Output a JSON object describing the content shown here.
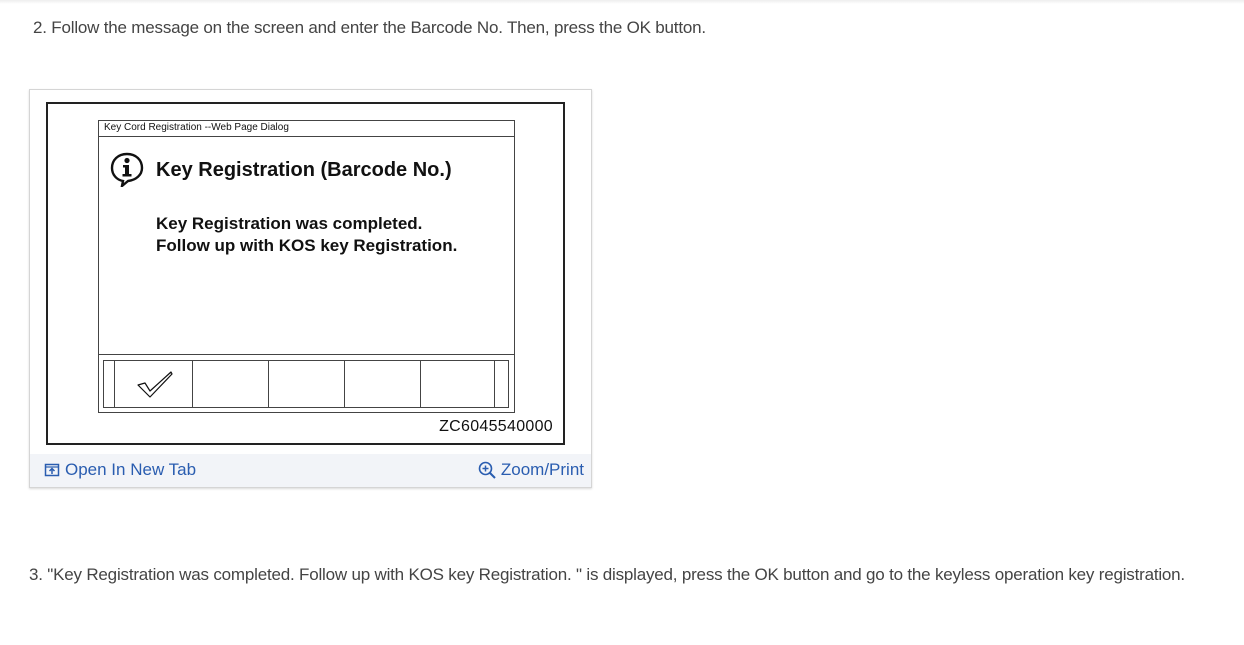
{
  "steps": {
    "step2": "2. Follow the message on the screen and enter the Barcode No. Then, press the OK button.",
    "step3": "3. \"Key Registration was completed. Follow up with KOS key Registration. \" is displayed, press the OK button and go to the keyless operation key registration."
  },
  "figure": {
    "dialog_title": "Key Cord  Registration --Web Page Dialog",
    "heading": "Key Registration (Barcode No.)",
    "message_line1": "Key Registration was completed.",
    "message_line2": "Follow up with KOS key Registration.",
    "code": "ZC6045540000",
    "icon_names": [
      "info-icon",
      "check-icon"
    ]
  },
  "footer": {
    "open_tab_label": "Open In New Tab",
    "zoom_print_label": "Zoom/Print",
    "link_color": "#2a5db0"
  }
}
